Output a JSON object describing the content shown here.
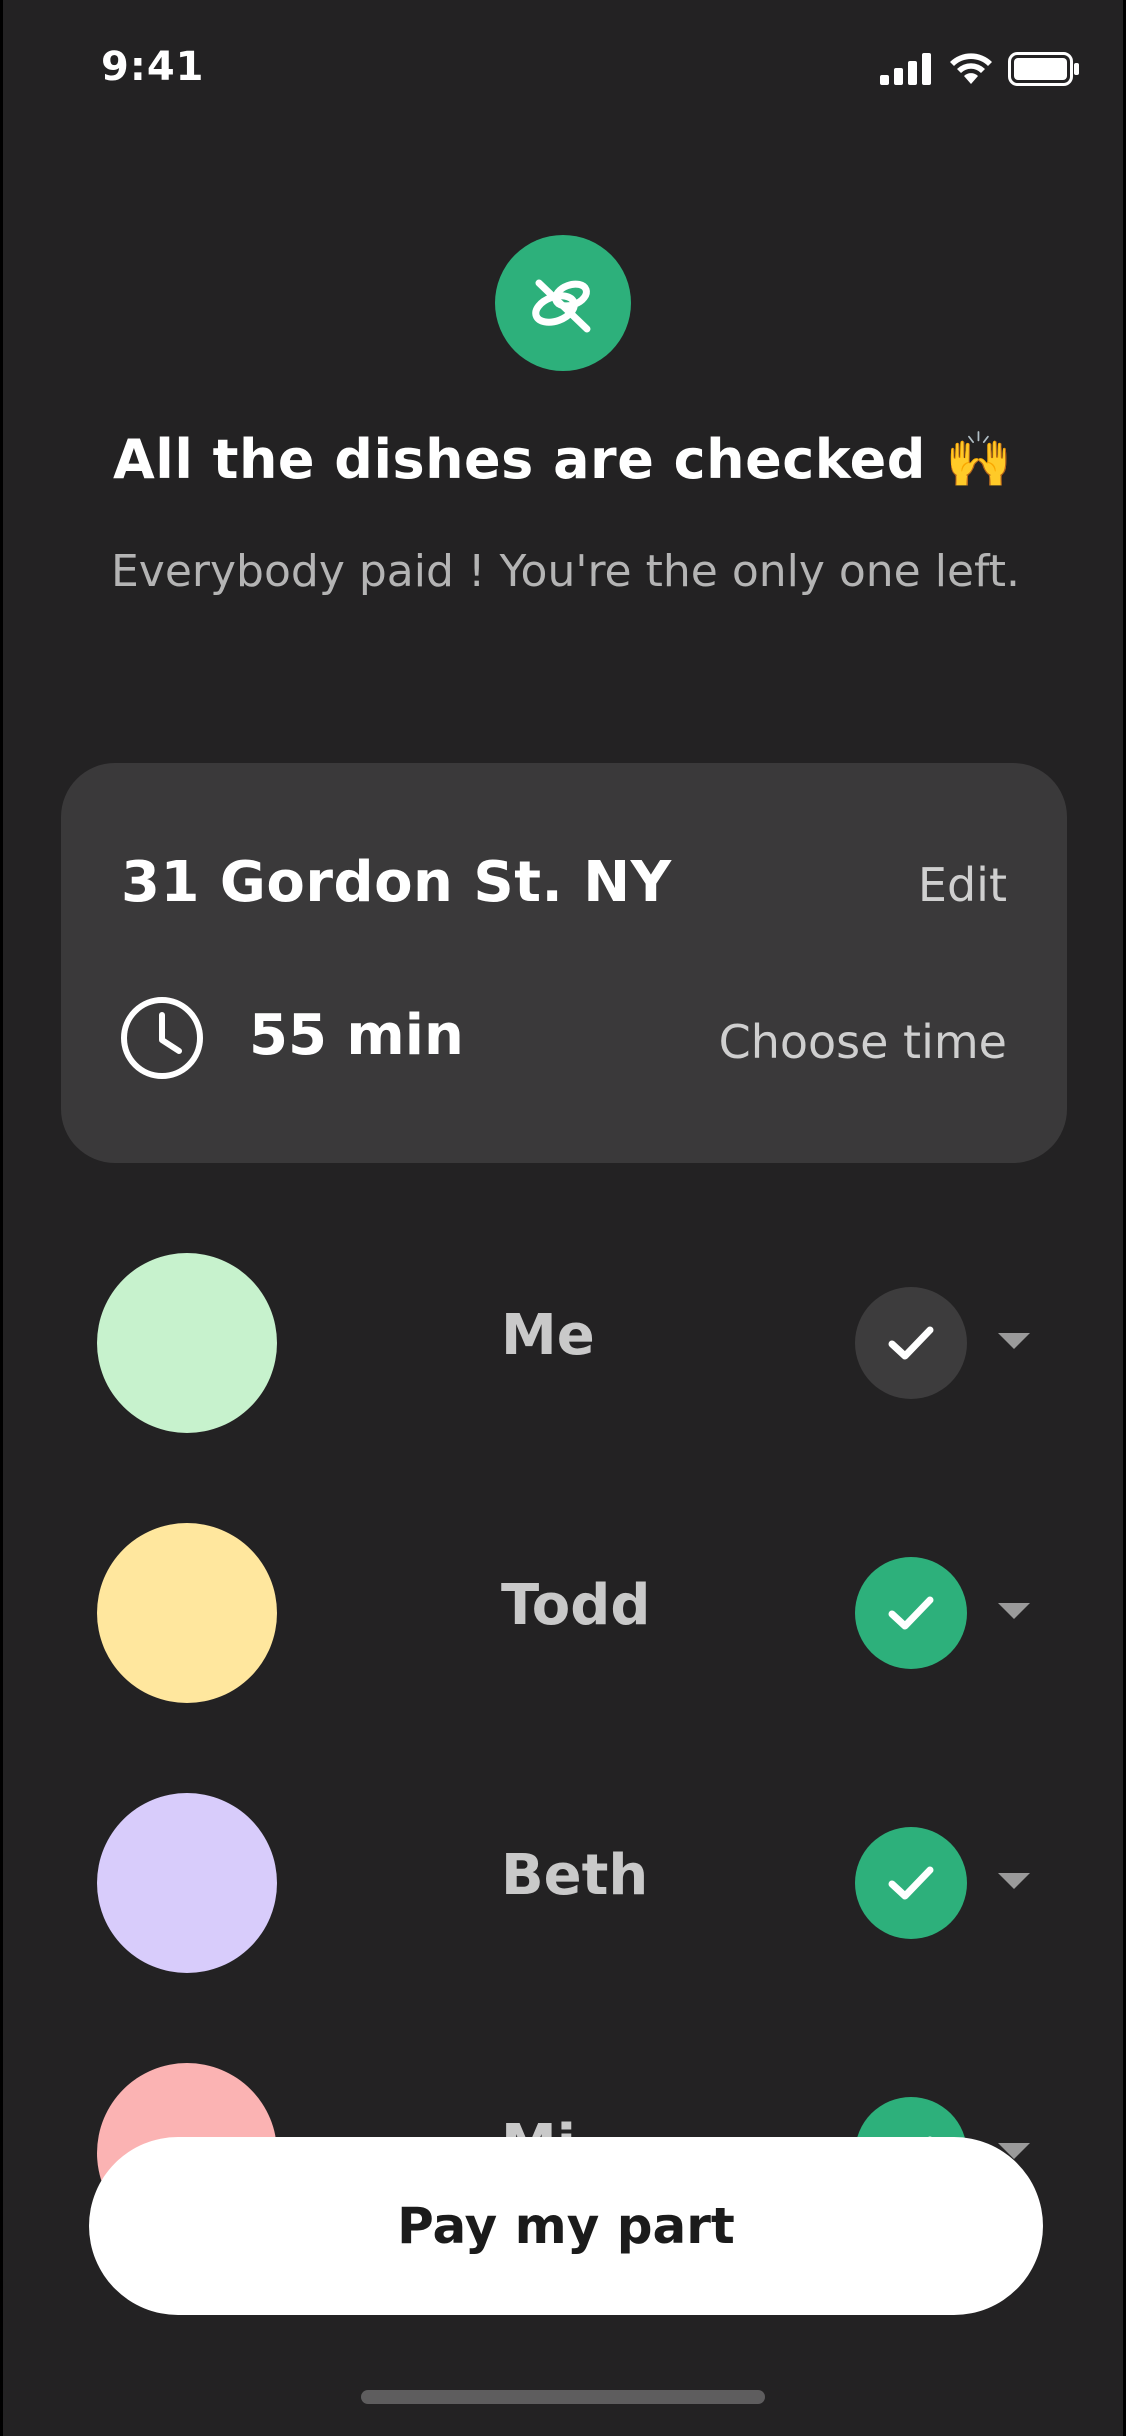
{
  "status_bar": {
    "time": "9:41"
  },
  "header": {
    "icon": "dishes-icon",
    "title": "All the dishes are checked 🙌",
    "subtitle": "Everybody paid ! You're the only one left."
  },
  "delivery": {
    "address": "31 Gordon St. NY",
    "edit_label": "Edit",
    "duration": "55 min",
    "choose_time_label": "Choose time"
  },
  "participants": [
    {
      "name": "Me",
      "paid": false,
      "avatar_color": "#c7f2cd"
    },
    {
      "name": "Todd",
      "paid": true,
      "avatar_color": "#ffe79e"
    },
    {
      "name": "Beth",
      "paid": true,
      "avatar_color": "#d8ccfb"
    },
    {
      "name": "Mi",
      "paid": true,
      "avatar_color": "#fbb3b3"
    }
  ],
  "actions": {
    "pay_label": "Pay my part"
  },
  "colors": {
    "background": "#232223",
    "card": "#3a393a",
    "accent_green": "#2db07b",
    "pending_circle": "#3d3c3d"
  }
}
